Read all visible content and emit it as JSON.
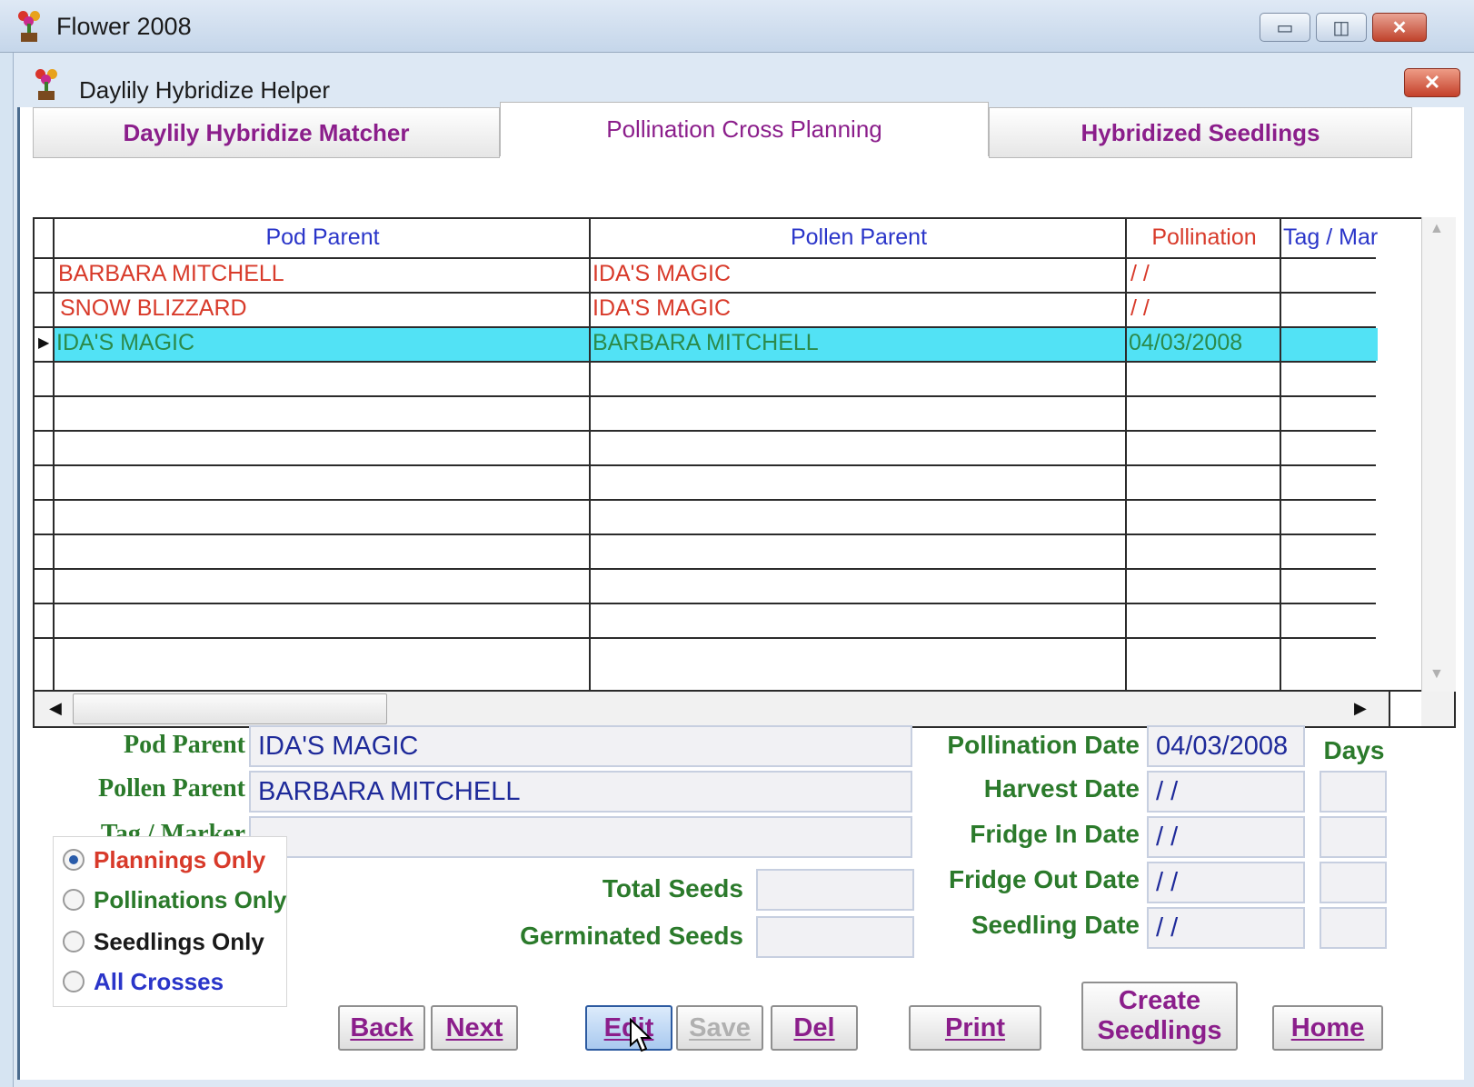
{
  "window": {
    "title": "Flower 2008",
    "minimize_glyph": "▭",
    "maximize_glyph": "◫",
    "close_glyph": "✕"
  },
  "form": {
    "title": "Daylily Hybridize Helper",
    "close_glyph": "✕"
  },
  "tabs": [
    {
      "label": "Daylily Hybridize Matcher",
      "active": false
    },
    {
      "label": "Pollination Cross Planning",
      "active": true
    },
    {
      "label": "Hybridized Seedlings",
      "active": false
    }
  ],
  "grid": {
    "columns": [
      "Pod Parent",
      "Pollen Parent",
      "Pollination",
      "Tag / Mar"
    ],
    "rows": [
      {
        "pod": "BARBARA MITCHELL",
        "pollen": "IDA'S MAGIC",
        "pollination": "/ /",
        "tag": ""
      },
      {
        "pod": "SNOW BLIZZARD",
        "pollen": "IDA'S MAGIC",
        "pollination": "/ /",
        "tag": ""
      },
      {
        "pod": "IDA'S MAGIC",
        "pollen": "BARBARA MITCHELL",
        "pollination": "04/03/2008",
        "tag": ""
      }
    ],
    "selected_row_marker": "▶",
    "scroll_left": "◀",
    "scroll_right": "▶",
    "scroll_up": "▲",
    "scroll_down": "▼"
  },
  "detail": {
    "pod_parent_label": "Pod Parent",
    "pod_parent_value": "IDA'S MAGIC",
    "pollen_parent_label": "Pollen Parent",
    "pollen_parent_value": "BARBARA MITCHELL",
    "tag_label": "Tag / Marker",
    "tag_value": "",
    "total_seeds_label": "Total  Seeds",
    "total_seeds_value": "",
    "germinated_seeds_label": "Germinated  Seeds",
    "germinated_seeds_value": "",
    "days_label": "Days",
    "dates": [
      {
        "label": "Pollination Date",
        "value": "04/03/2008",
        "days": null
      },
      {
        "label": "Harvest Date",
        "value": " /  /",
        "days": ""
      },
      {
        "label": "Fridge In Date",
        "value": " /  /",
        "days": ""
      },
      {
        "label": "Fridge Out Date",
        "value": " /  /",
        "days": ""
      },
      {
        "label": "Seedling Date",
        "value": " /  /",
        "days": ""
      }
    ]
  },
  "filter": {
    "options": [
      {
        "label": "Plannings Only",
        "selected": true,
        "color": "#d83a2a"
      },
      {
        "label": "Pollinations Only",
        "selected": false,
        "color": "#2b7a2b"
      },
      {
        "label": "Seedlings Only",
        "selected": false,
        "color": "#1a1a1a"
      },
      {
        "label": "All Crosses",
        "selected": false,
        "color": "#2a35c9"
      }
    ]
  },
  "buttons": {
    "back": "Back",
    "next": "Next",
    "edit": "Edit",
    "save": "Save",
    "del": "Del",
    "print": "Print",
    "create_line1": "Create",
    "create_line2": "Seedlings",
    "home": "Home"
  },
  "colors": {
    "row_selected_bg": "#52e2f5",
    "pod_text": "#d83a2a",
    "selected_text": "#2b8a4a",
    "header_blue": "#2a35c9",
    "header_red": "#d83a2a"
  }
}
